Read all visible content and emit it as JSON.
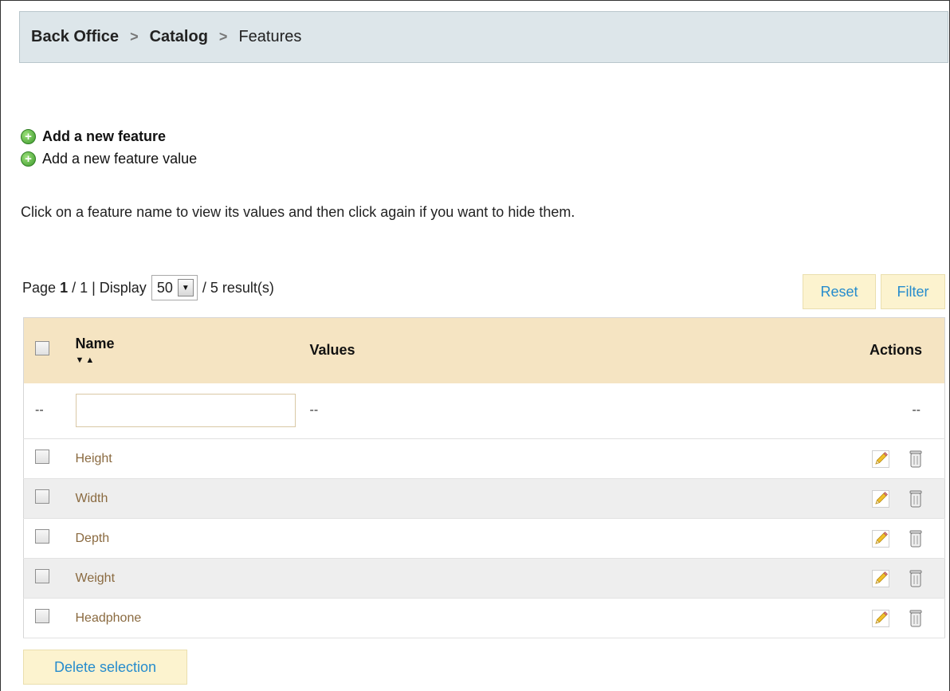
{
  "breadcrumb": {
    "items": [
      "Back Office",
      "Catalog",
      "Features"
    ],
    "separator": ">"
  },
  "links": {
    "add_feature": "Add a new feature",
    "add_feature_value": "Add a new feature value"
  },
  "hint": "Click on a feature name to view its values and then click again if you want to hide them.",
  "pager": {
    "page_label": "Page",
    "current": "1",
    "total_text": "/ 1 | Display",
    "per_page": "50",
    "results_text": "/ 5 result(s)"
  },
  "buttons": {
    "reset": "Reset",
    "filter": "Filter",
    "delete_selection": "Delete selection"
  },
  "table": {
    "headers": {
      "name": "Name",
      "values": "Values",
      "actions": "Actions"
    },
    "sort_glyphs": "▼▲",
    "filter_row": {
      "dash": "--",
      "name_value": ""
    },
    "rows": [
      {
        "name": "Height"
      },
      {
        "name": "Width"
      },
      {
        "name": "Depth"
      },
      {
        "name": "Weight"
      },
      {
        "name": "Headphone"
      }
    ]
  },
  "colors": {
    "breadcrumb_bg": "#dde6ea",
    "table_header_bg": "#f5e4c2",
    "button_bg": "#fcf3cf",
    "button_text": "#268ccd",
    "row_link": "#8a6a40"
  }
}
